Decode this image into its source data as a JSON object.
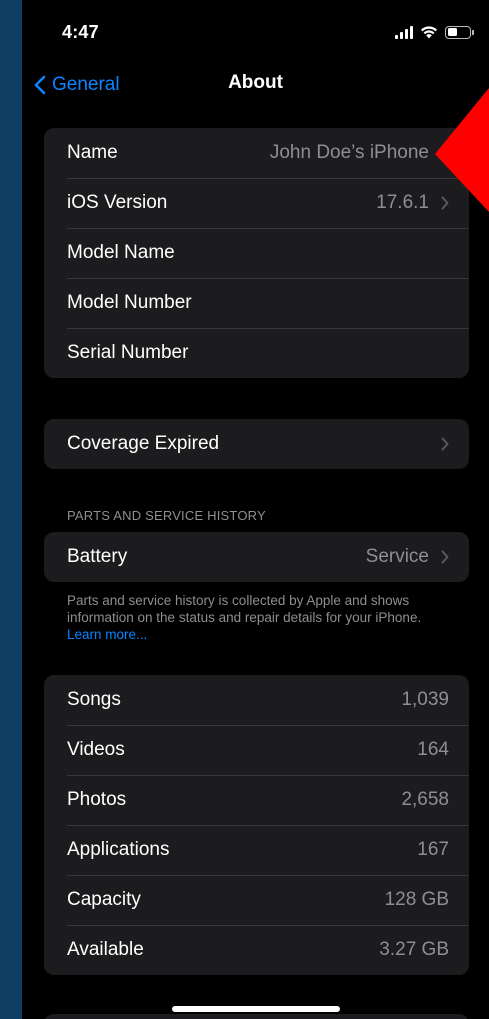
{
  "status_bar": {
    "time": "4:47",
    "battery_level": 0.45
  },
  "nav": {
    "back_label": "General",
    "title": "About"
  },
  "device_group": [
    {
      "label": "Name",
      "value": "John Doe’s iPhone",
      "chevron": true
    },
    {
      "label": "iOS Version",
      "value": "17.6.1",
      "chevron": true
    },
    {
      "label": "Model Name",
      "value": "",
      "chevron": false
    },
    {
      "label": "Model Number",
      "value": "",
      "chevron": false
    },
    {
      "label": "Serial Number",
      "value": "",
      "chevron": false
    }
  ],
  "coverage": {
    "label": "Coverage Expired",
    "chevron": true
  },
  "parts_section": {
    "header": "PARTS AND SERVICE HISTORY",
    "battery_label": "Battery",
    "battery_value": "Service",
    "footer_text": "Parts and service history is collected by Apple and shows information on the status and repair details for your iPhone.",
    "footer_link": "Learn more..."
  },
  "stats_group": [
    {
      "label": "Songs",
      "value": "1,039"
    },
    {
      "label": "Videos",
      "value": "164"
    },
    {
      "label": "Photos",
      "value": "2,658"
    },
    {
      "label": "Applications",
      "value": "167"
    },
    {
      "label": "Capacity",
      "value": "128 GB"
    },
    {
      "label": "Available",
      "value": "3.27 GB"
    }
  ],
  "colors": {
    "accent": "#0a84ff",
    "background_frame": "#0e3f63",
    "cell": "#1c1c1e",
    "secondary_text": "#8e8e93",
    "annotation_arrow": "#ff0000"
  }
}
